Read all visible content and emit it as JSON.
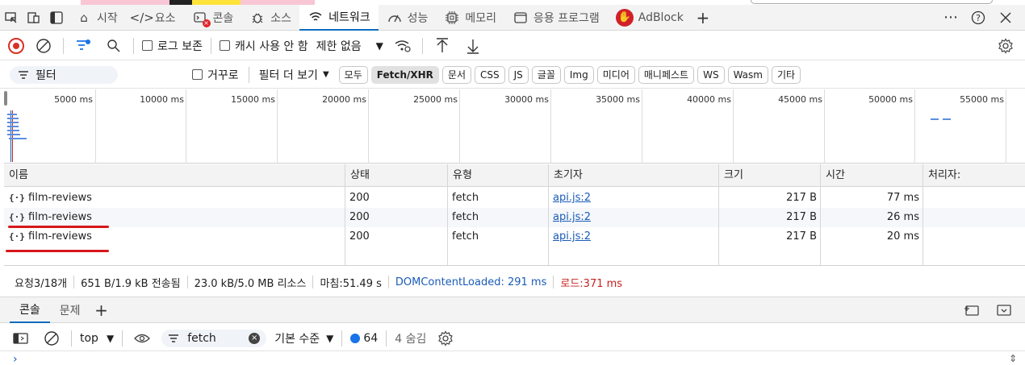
{
  "tabs": [
    {
      "label": "시작",
      "icon": "home-icon"
    },
    {
      "label": "요소",
      "icon": "code-icon"
    },
    {
      "label": "콘솔",
      "icon": "console-icon"
    },
    {
      "label": "소스",
      "icon": "bug-icon"
    },
    {
      "label": "네트워크",
      "icon": "wifi-icon",
      "active": true
    },
    {
      "label": "성능",
      "icon": "gauge-icon"
    },
    {
      "label": "메모리",
      "icon": "chip-icon"
    },
    {
      "label": "응용 프로그램",
      "icon": "window-icon"
    },
    {
      "label": "AdBlock",
      "icon": "adblock-icon"
    }
  ],
  "toolbar": {
    "preserve_log": "로그 보존",
    "disable_cache": "캐시 사용 안 함",
    "throttle": "제한 없음"
  },
  "filter": {
    "placeholder": "필터",
    "invert": "거꾸로",
    "more_filters": "필터 더 보기",
    "types": [
      "모두",
      "Fetch/XHR",
      "문서",
      "CSS",
      "JS",
      "글꼴",
      "Img",
      "미디어",
      "매니페스트",
      "WS",
      "Wasm",
      "기타"
    ],
    "selected": "Fetch/XHR"
  },
  "overview": {
    "ticks": [
      "5000 ms",
      "10000 ms",
      "15000 ms",
      "20000 ms",
      "25000 ms",
      "30000 ms",
      "35000 ms",
      "40000 ms",
      "45000 ms",
      "50000 ms",
      "55000 ms"
    ]
  },
  "table": {
    "headers": [
      "이름",
      "상태",
      "유형",
      "초기자",
      "크기",
      "시간",
      "처리자:"
    ],
    "rows": [
      {
        "name": "film-reviews",
        "status": "200",
        "type": "fetch",
        "initiator": "api.js:2",
        "size": "217 B",
        "time": "77 ms"
      },
      {
        "name": "film-reviews",
        "status": "200",
        "type": "fetch",
        "initiator": "api.js:2",
        "size": "217 B",
        "time": "26 ms"
      },
      {
        "name": "film-reviews",
        "status": "200",
        "type": "fetch",
        "initiator": "api.js:2",
        "size": "217 B",
        "time": "20 ms"
      }
    ]
  },
  "status": {
    "requests": "요청3/18개",
    "transferred": "651 B/1.9 kB 전송됨",
    "resources": "23.0 kB/5.0 MB 리소스",
    "finish": "마침:51.49 s",
    "dcl": "DOMContentLoaded: 291 ms",
    "load": "로드:371 ms",
    "dcl_color": "#1a5bb8",
    "load_color": "#c5221f"
  },
  "drawer": {
    "tabs": [
      "콘솔",
      "문제"
    ]
  },
  "console": {
    "context": "top",
    "filter_value": "fetch",
    "level": "기본 수준",
    "messages": "64",
    "hidden": "4 숨김"
  }
}
